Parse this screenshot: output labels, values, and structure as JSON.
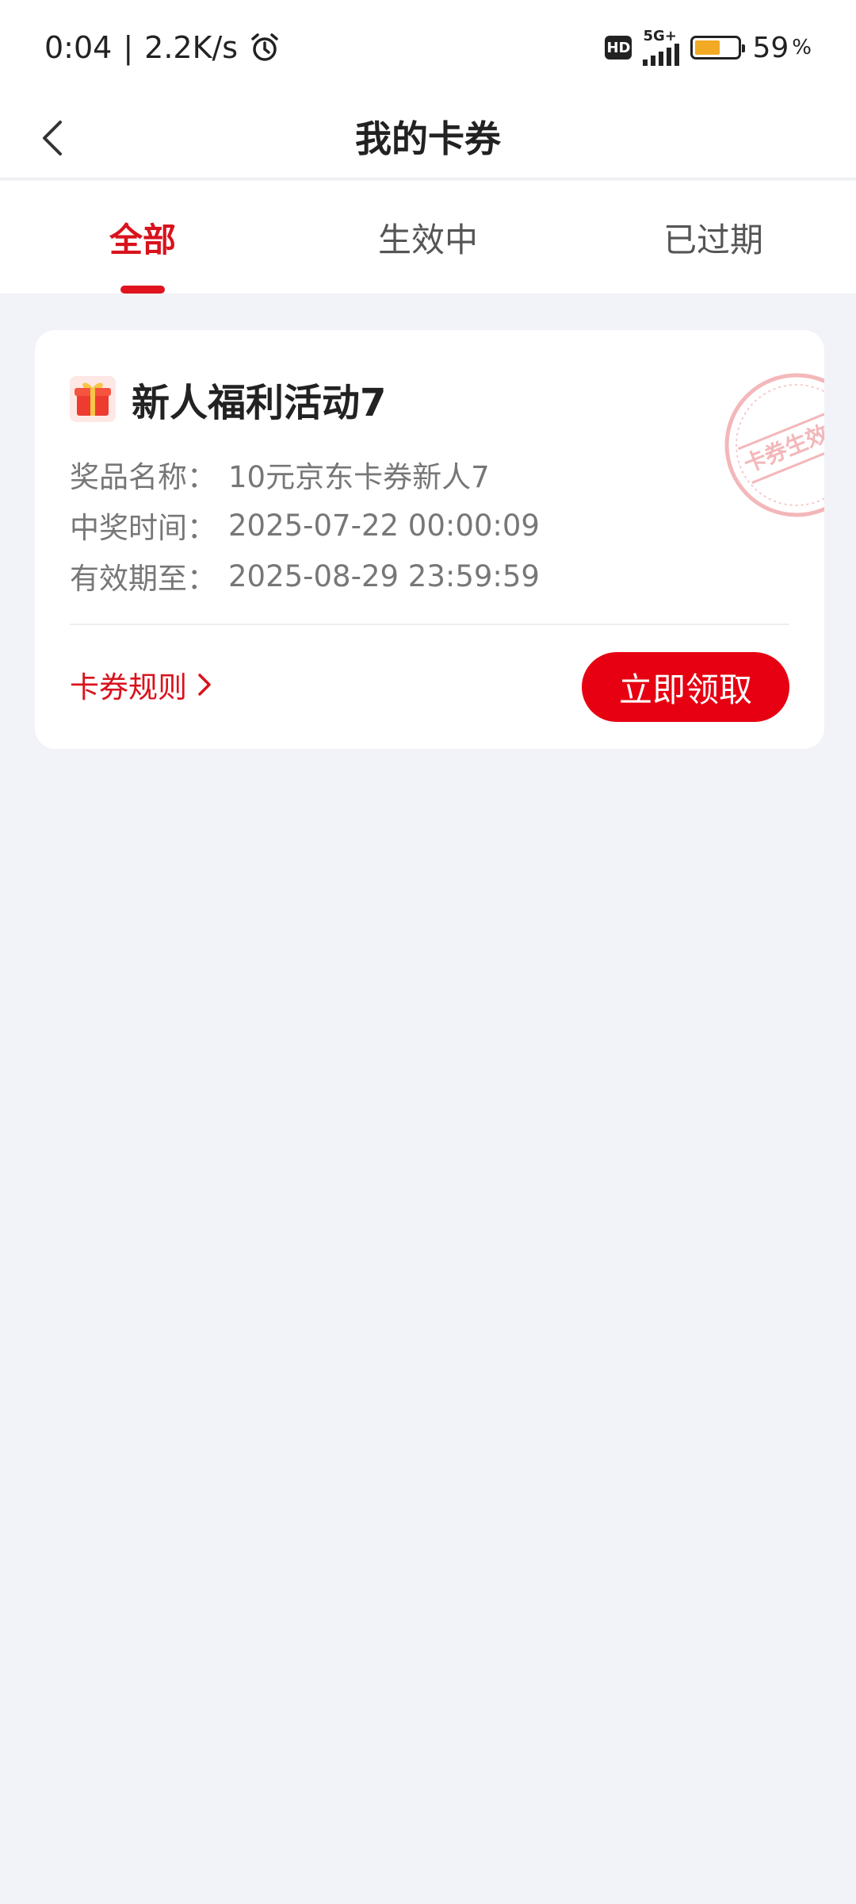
{
  "status_bar": {
    "time": "0:04",
    "separator": "|",
    "speed": "2.2K/s",
    "hd": "HD",
    "network": "5G+",
    "battery_percent": "59",
    "battery_level": 0.59,
    "percent_sign": "%"
  },
  "nav": {
    "title": "我的卡券"
  },
  "tabs": [
    {
      "label": "全部",
      "active": true
    },
    {
      "label": "生效中",
      "active": false
    },
    {
      "label": "已过期",
      "active": false
    }
  ],
  "coupon": {
    "title": "新人福利活动7",
    "rows": [
      {
        "label": "奖品名称：",
        "value": "10元京东卡券新人7"
      },
      {
        "label": "中奖时间：",
        "value": "2025-07-22 00:00:09"
      },
      {
        "label": "有效期至：",
        "value": "2025-08-29 23:59:59"
      }
    ],
    "stamp_text": "卡券生效中",
    "rules_label": "卡券规则",
    "claim_label": "立即领取"
  },
  "colors": {
    "accent": "#e60012",
    "background": "#f2f3f8"
  }
}
